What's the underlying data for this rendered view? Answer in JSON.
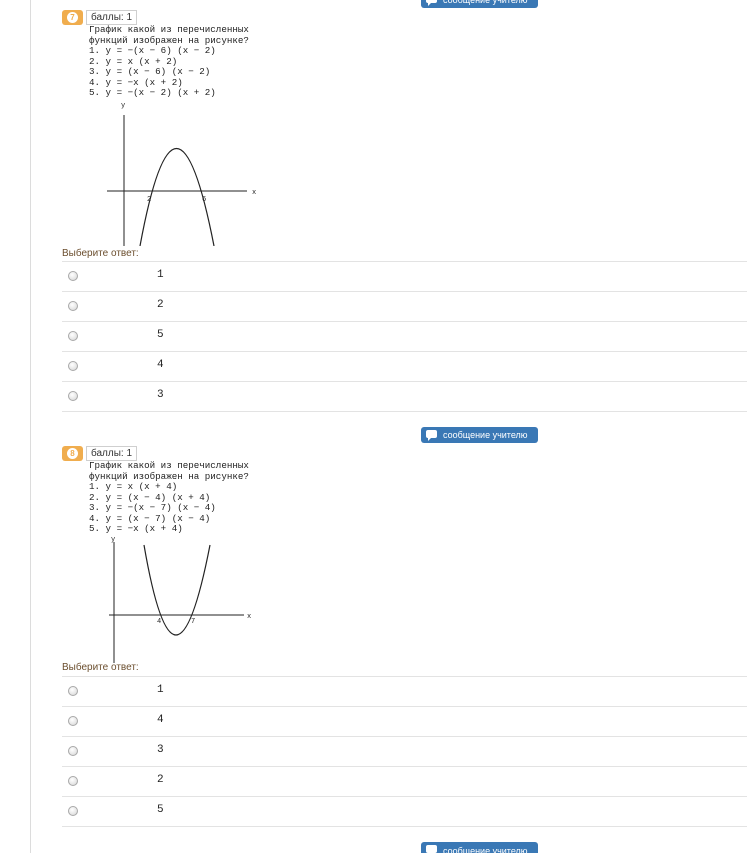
{
  "message_button_label": "сообщение учителю",
  "questions": [
    {
      "number": "7",
      "points": "баллы: 1",
      "text": "График какой из перечисленных\nфункций изображен на рисунке?\n1. y = −(x − 6) (x − 2)\n2. y = x (x + 2)\n3. y = (x − 6) (x − 2)\n4. y = −x (x + 2)\n5. y = −(x − 2) (x + 2)",
      "graph": {
        "axis_y": "y",
        "axis_x": "x",
        "root1": "2",
        "root2": "6"
      },
      "prompt": "Выберите ответ:",
      "answers": [
        "1",
        "2",
        "5",
        "4",
        "3"
      ]
    },
    {
      "number": "8",
      "points": "баллы: 1",
      "text": "График какой из перечисленных\nфункций изображен на рисунке?\n1. y = x (x + 4)\n2. y = (x − 4) (x + 4)\n3. y = −(x − 7) (x − 4)\n4. y = (x − 7) (x − 4)\n5. y = −x (x + 4)",
      "graph": {
        "axis_y": "y",
        "axis_x": "x",
        "root1": "4",
        "root2": "7"
      },
      "prompt": "Выберите ответ:",
      "answers": [
        "1",
        "4",
        "3",
        "2",
        "5"
      ]
    }
  ]
}
